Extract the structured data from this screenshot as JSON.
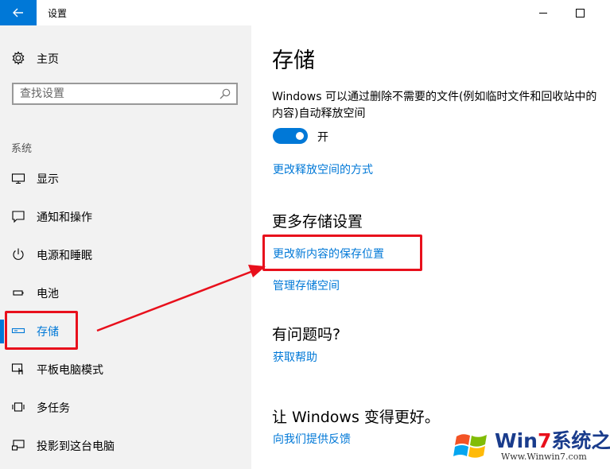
{
  "window": {
    "title": "设置"
  },
  "sidebar": {
    "home_label": "主页",
    "search_placeholder": "查找设置",
    "section_label": "系统",
    "items": [
      {
        "label": "显示",
        "icon": "monitor-icon"
      },
      {
        "label": "通知和操作",
        "icon": "notification-icon"
      },
      {
        "label": "电源和睡眠",
        "icon": "power-icon"
      },
      {
        "label": "电池",
        "icon": "battery-icon"
      },
      {
        "label": "存储",
        "icon": "storage-icon",
        "selected": true
      },
      {
        "label": "平板电脑模式",
        "icon": "tablet-mode-icon"
      },
      {
        "label": "多任务",
        "icon": "multitask-icon"
      },
      {
        "label": "投影到这台电脑",
        "icon": "project-icon"
      }
    ]
  },
  "main": {
    "title": "存储",
    "description": "Windows 可以通过删除不需要的文件(例如临时文件和回收站中的内容)自动释放空间",
    "toggle_label": "开",
    "toggle_on": true,
    "change_free_link": "更改释放空间的方式",
    "more_heading": "更多存储设置",
    "change_save_link": "更改新内容的保存位置",
    "manage_link": "管理存储空间",
    "help_heading": "有问题吗?",
    "help_link": "获取帮助",
    "improve_heading": "让 Windows 变得更好。",
    "feedback_link": "向我们提供反馈"
  },
  "watermark": {
    "brand_prefix": "Win",
    "brand_highlight": "7",
    "brand_suffix": "系统之家",
    "url": "Www.Winwin7.com"
  },
  "colors": {
    "accent": "#0078d7",
    "sidebar_bg": "#f2f2f2",
    "annotation_red": "#e8101c"
  }
}
